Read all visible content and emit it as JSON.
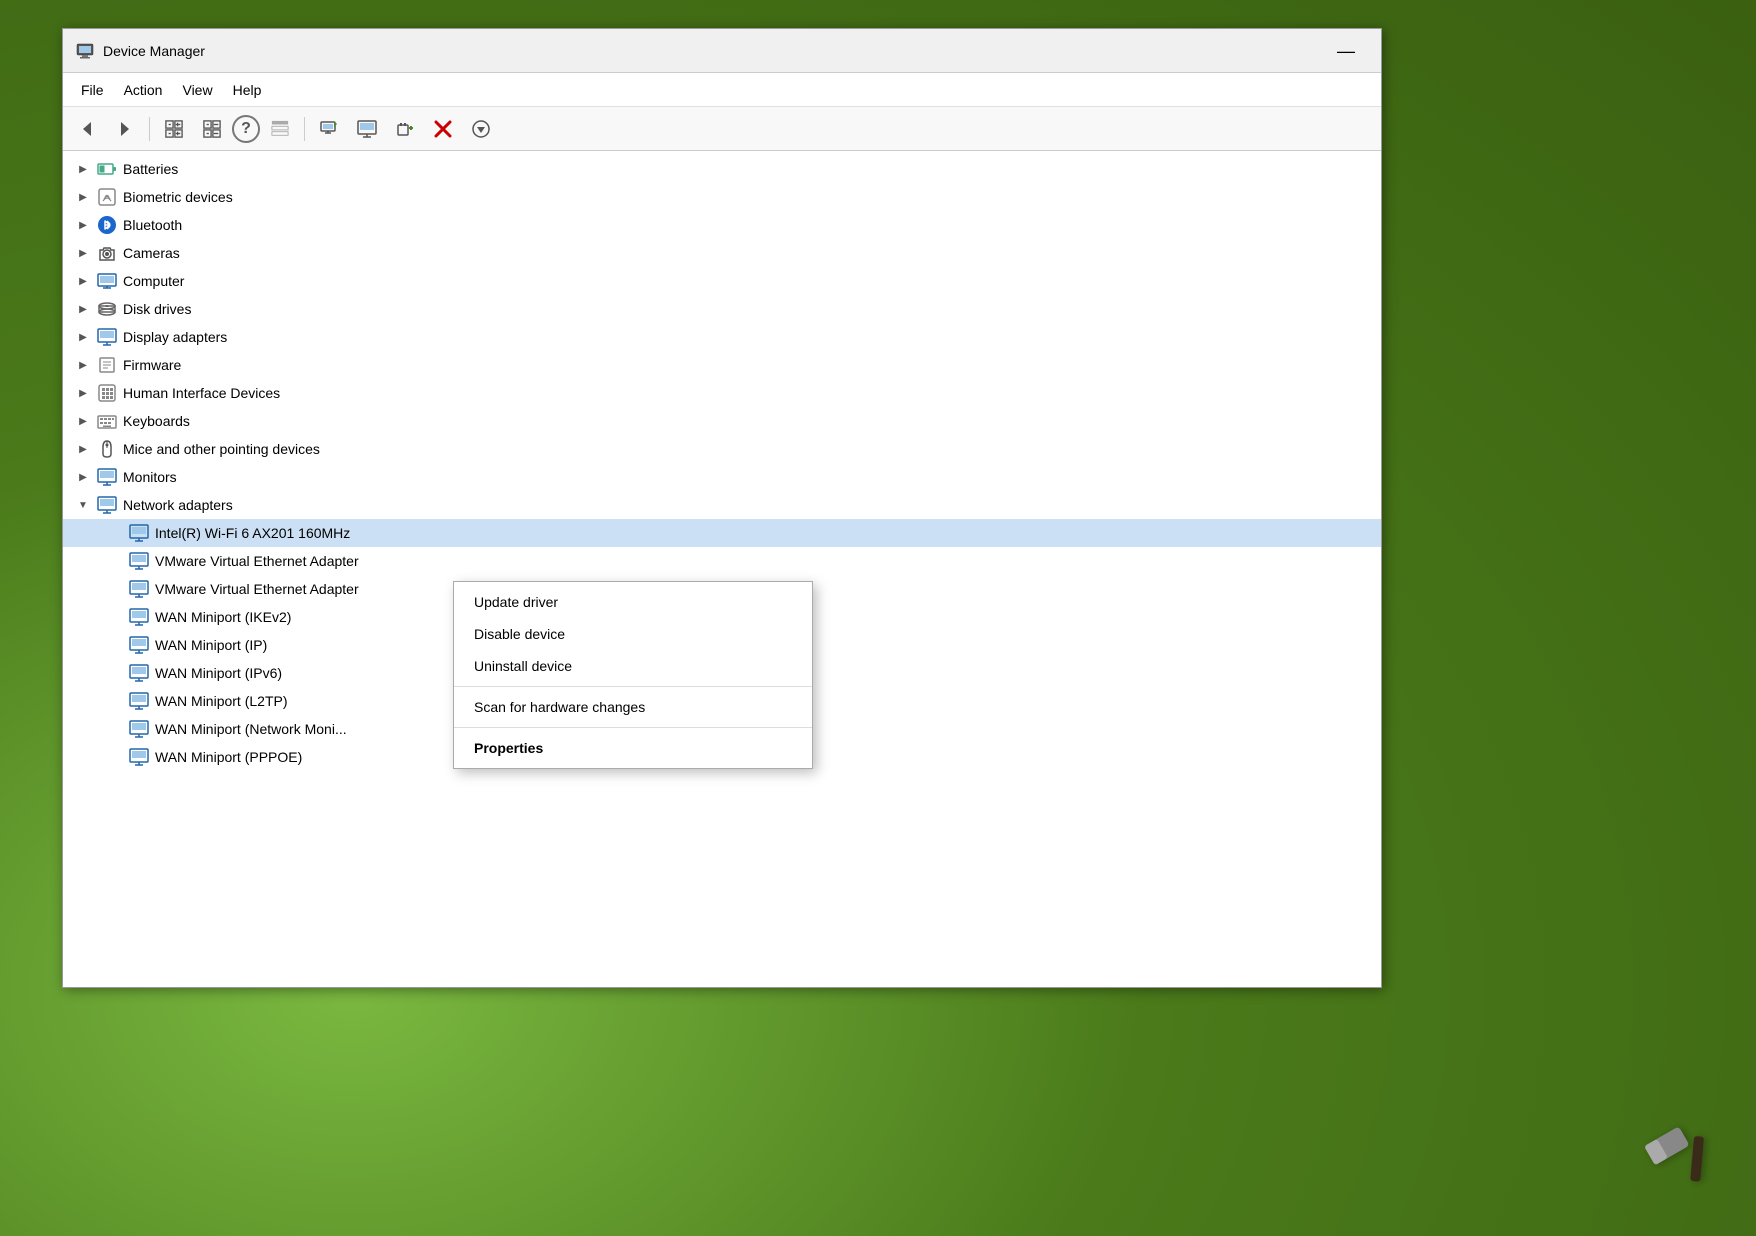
{
  "window": {
    "title": "Device Manager",
    "icon": "device-manager-icon"
  },
  "menu": {
    "items": [
      "File",
      "Action",
      "View",
      "Help"
    ]
  },
  "toolbar": {
    "buttons": [
      {
        "name": "back-button",
        "icon": "◀",
        "label": "Back"
      },
      {
        "name": "forward-button",
        "icon": "▶",
        "label": "Forward"
      },
      {
        "name": "expand-button",
        "icon": "⊞",
        "label": "Expand"
      },
      {
        "name": "collapse-button",
        "icon": "⊟",
        "label": "Collapse"
      },
      {
        "name": "properties-button",
        "icon": "?",
        "label": "Properties"
      },
      {
        "name": "details-button",
        "icon": "≡",
        "label": "Details"
      },
      {
        "name": "update-driver-button",
        "icon": "⤒",
        "label": "Update Driver"
      },
      {
        "name": "monitor-button",
        "icon": "🖥",
        "label": "Monitor"
      },
      {
        "name": "add-device-button",
        "icon": "+",
        "label": "Add Device"
      },
      {
        "name": "remove-device-button",
        "icon": "✕",
        "label": "Remove Device",
        "color": "red"
      },
      {
        "name": "scan-button",
        "icon": "⬇",
        "label": "Scan for hardware changes"
      }
    ]
  },
  "device_tree": {
    "items": [
      {
        "id": "batteries",
        "label": "Batteries",
        "icon": "battery",
        "expanded": false,
        "indent": 0
      },
      {
        "id": "biometric",
        "label": "Biometric devices",
        "icon": "biometric",
        "expanded": false,
        "indent": 0
      },
      {
        "id": "bluetooth",
        "label": "Bluetooth",
        "icon": "bluetooth",
        "expanded": false,
        "indent": 0
      },
      {
        "id": "cameras",
        "label": "Cameras",
        "icon": "camera",
        "expanded": false,
        "indent": 0
      },
      {
        "id": "computer",
        "label": "Computer",
        "icon": "computer",
        "expanded": false,
        "indent": 0
      },
      {
        "id": "disk",
        "label": "Disk drives",
        "icon": "disk",
        "expanded": false,
        "indent": 0
      },
      {
        "id": "display",
        "label": "Display adapters",
        "icon": "display",
        "expanded": false,
        "indent": 0
      },
      {
        "id": "firmware",
        "label": "Firmware",
        "icon": "firmware",
        "expanded": false,
        "indent": 0
      },
      {
        "id": "hid",
        "label": "Human Interface Devices",
        "icon": "hid",
        "expanded": false,
        "indent": 0
      },
      {
        "id": "keyboards",
        "label": "Keyboards",
        "icon": "keyboard",
        "expanded": false,
        "indent": 0
      },
      {
        "id": "mice",
        "label": "Mice and other pointing devices",
        "icon": "mouse",
        "expanded": false,
        "indent": 0
      },
      {
        "id": "monitors",
        "label": "Monitors",
        "icon": "monitor",
        "expanded": false,
        "indent": 0
      },
      {
        "id": "network",
        "label": "Network adapters",
        "icon": "network",
        "expanded": true,
        "indent": 0
      },
      {
        "id": "wifi",
        "label": "Intel(R) Wi-Fi 6 AX201 160MHz",
        "icon": "network",
        "expanded": false,
        "indent": 1,
        "selected": true
      },
      {
        "id": "vmware1",
        "label": "VMware Virtual Ethernet Adapter",
        "icon": "network",
        "expanded": false,
        "indent": 1
      },
      {
        "id": "vmware2",
        "label": "VMware Virtual Ethernet Adapter",
        "icon": "network",
        "expanded": false,
        "indent": 1
      },
      {
        "id": "wan_ikev2",
        "label": "WAN Miniport (IKEv2)",
        "icon": "network",
        "expanded": false,
        "indent": 1
      },
      {
        "id": "wan_ip",
        "label": "WAN Miniport (IP)",
        "icon": "network",
        "expanded": false,
        "indent": 1
      },
      {
        "id": "wan_ipv6",
        "label": "WAN Miniport (IPv6)",
        "icon": "network",
        "expanded": false,
        "indent": 1
      },
      {
        "id": "wan_l2tp",
        "label": "WAN Miniport (L2TP)",
        "icon": "network",
        "expanded": false,
        "indent": 1
      },
      {
        "id": "wan_netmon",
        "label": "WAN Miniport (Network Moni...",
        "icon": "network",
        "expanded": false,
        "indent": 1
      },
      {
        "id": "wan_pppoe",
        "label": "WAN Miniport (PPPOE)",
        "icon": "network",
        "expanded": false,
        "indent": 1
      }
    ]
  },
  "context_menu": {
    "items": [
      {
        "id": "update-driver",
        "label": "Update driver",
        "bold": false,
        "separator_after": false
      },
      {
        "id": "disable-device",
        "label": "Disable device",
        "bold": false,
        "separator_after": false
      },
      {
        "id": "uninstall-device",
        "label": "Uninstall device",
        "bold": false,
        "separator_after": true
      },
      {
        "id": "scan-hardware",
        "label": "Scan for hardware changes",
        "bold": false,
        "separator_after": true
      },
      {
        "id": "properties",
        "label": "Properties",
        "bold": true,
        "separator_after": false
      }
    ]
  }
}
